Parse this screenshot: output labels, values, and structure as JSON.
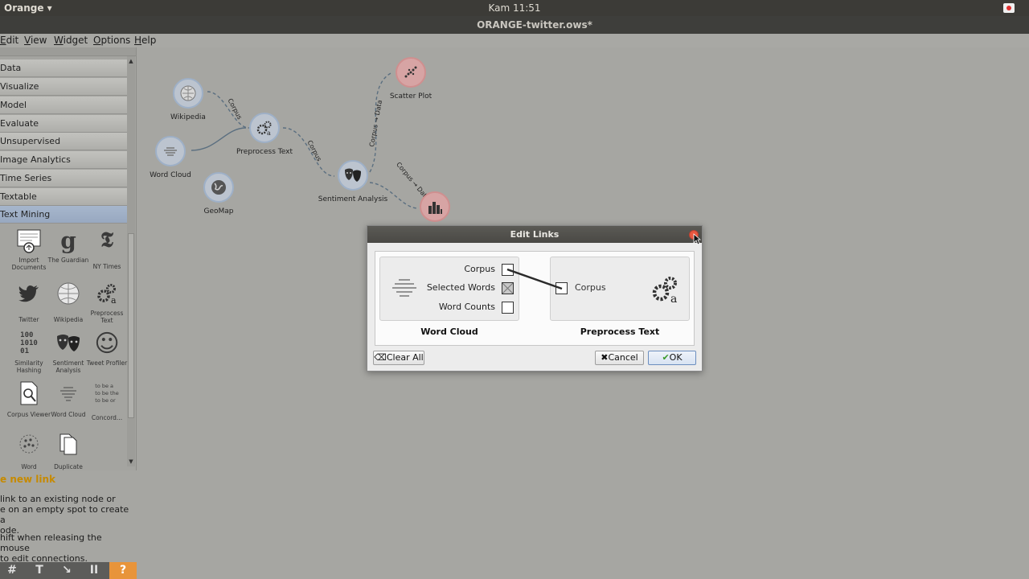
{
  "topbar": {
    "app_name": "Orange ▾",
    "clock": "Kam 11:51"
  },
  "window": {
    "title": "ORANGE-twitter.ows*"
  },
  "menu": [
    "Edit",
    "View",
    "Widget",
    "Options",
    "Help"
  ],
  "categories": [
    "Data",
    "Visualize",
    "Model",
    "Evaluate",
    "Unsupervised",
    "Image Analytics",
    "Time Series",
    "Textable",
    "Text Mining"
  ],
  "tools": [
    {
      "icon": "import-documents-icon",
      "label": "Import Documents"
    },
    {
      "icon": "the-guardian-icon",
      "label": "The Guardian",
      "glyph": "g"
    },
    {
      "icon": "ny-times-icon",
      "label": "NY Times",
      "glyph": "𝕿"
    },
    {
      "icon": "twitter-icon",
      "label": "Twitter"
    },
    {
      "icon": "wikipedia-icon",
      "label": "Wikipedia"
    },
    {
      "icon": "preprocess-text-icon",
      "label": "Preprocess Text"
    },
    {
      "icon": "similarity-hashing-icon",
      "label": "Similarity Hashing",
      "glyph": "100\n1010\n01"
    },
    {
      "icon": "sentiment-analysis-icon",
      "label": "Sentiment Analysis"
    },
    {
      "icon": "tweet-profiler-icon",
      "label": "Tweet Profiler",
      "glyph": "☺"
    },
    {
      "icon": "corpus-viewer-icon",
      "label": "Corpus Viewer"
    },
    {
      "icon": "word-cloud-icon",
      "label": "Word Cloud"
    },
    {
      "icon": "concordance-icon",
      "label": "Concord...",
      "glyph": "to be a\nto be the\nto be or"
    },
    {
      "icon": "word-enrichment-icon",
      "label": "Word"
    },
    {
      "icon": "duplicate-detection-icon",
      "label": "Duplicate"
    }
  ],
  "help": {
    "title": "e new link",
    "p1": "link to an existing node or\ne on an empty spot to create a\node.",
    "p2": "hift when releasing the mouse\nto edit connections."
  },
  "toolbar": [
    "#",
    "T",
    "↘",
    "II",
    "?"
  ],
  "nodes": {
    "wikipedia": "Wikipedia",
    "preprocess_text": "Preprocess Text",
    "word_cloud": "Word Cloud",
    "geomap": "GeoMap",
    "scatter_plot": "Scatter Plot",
    "sentiment_analysis": "Sentiment Analysis"
  },
  "link_labels": {
    "wiki_pre": "Corpus",
    "pre_sent": "Corpus",
    "sent_scatter": "Corpus → Data",
    "sent_bar": "Corpus → Data"
  },
  "dialog": {
    "title": "Edit Links",
    "source": {
      "name": "Word Cloud",
      "channels": [
        "Corpus",
        "Selected Words",
        "Word Counts"
      ]
    },
    "target": {
      "name": "Preprocess Text",
      "channels": [
        "Corpus"
      ]
    },
    "clear_all": "Clear All",
    "cancel": "Cancel",
    "ok": "OK"
  },
  "colors": {
    "topbar": "#3c3b37",
    "canvas": "#a6a6a2",
    "node_blue": "#bcc4cf",
    "node_red": "#d7a4a4",
    "active_category": "#a6b6cc",
    "help_title": "#c68a00",
    "help_button": "#e8943a",
    "close_button": "#e9573f"
  }
}
